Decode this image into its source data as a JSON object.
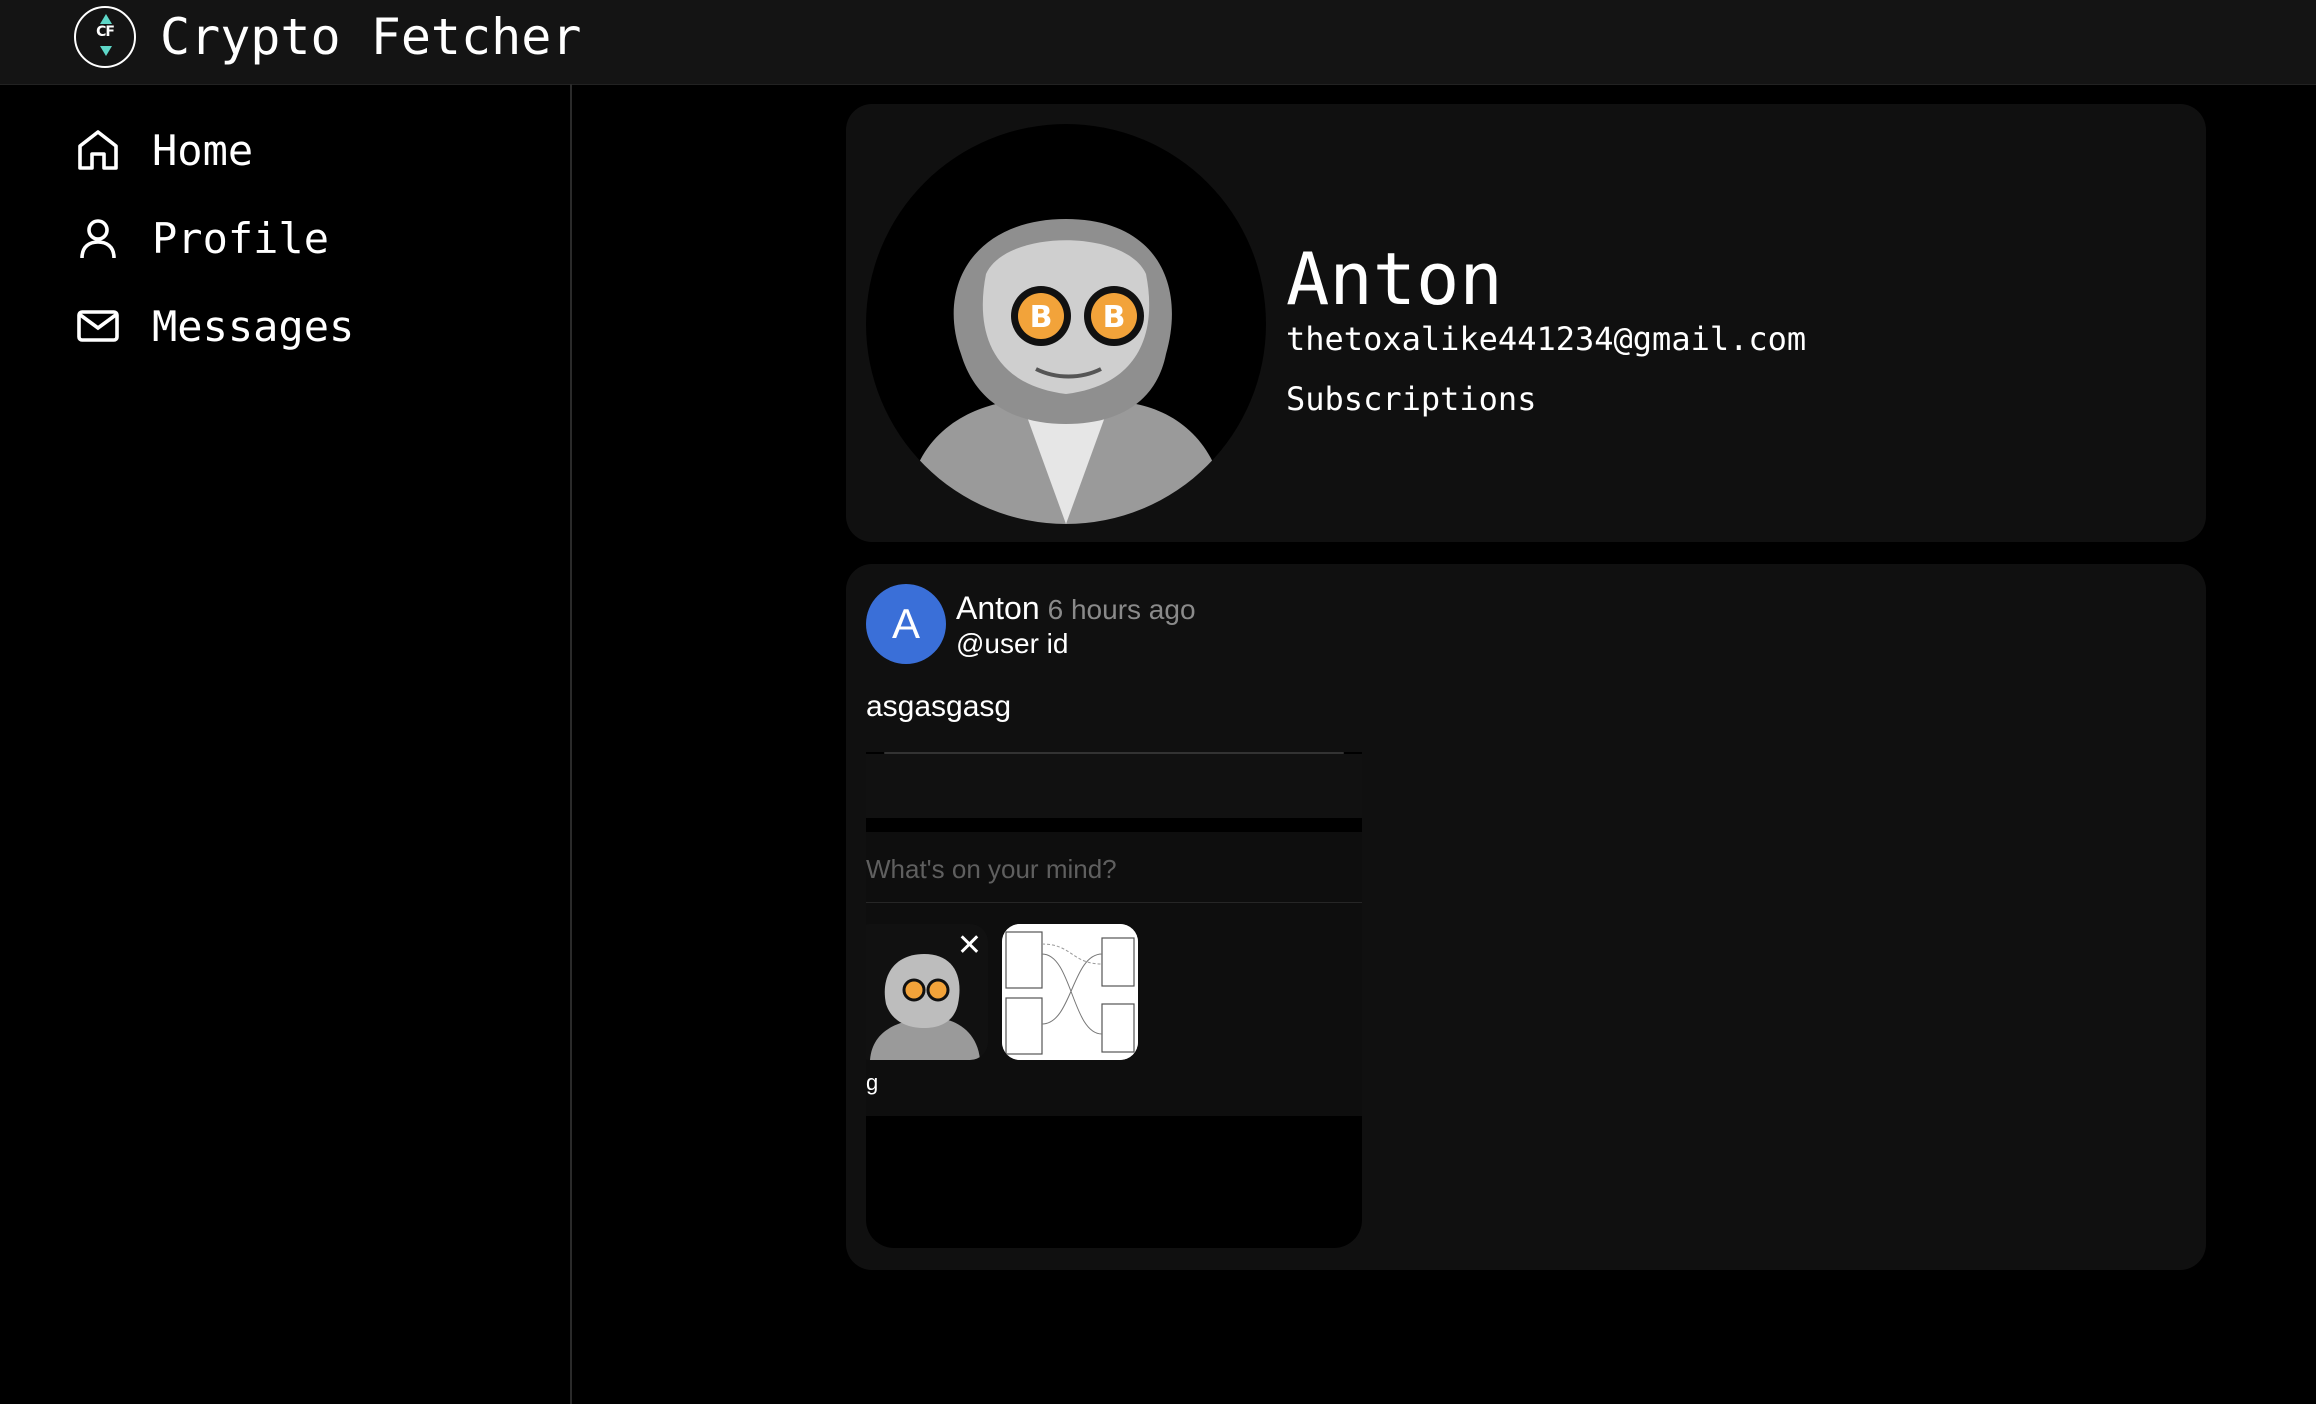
{
  "app": {
    "title": "Crypto Fetcher",
    "logo_text": "CF"
  },
  "sidebar": {
    "items": [
      {
        "label": "Home",
        "icon": "home-icon"
      },
      {
        "label": "Profile",
        "icon": "user-icon"
      },
      {
        "label": "Messages",
        "icon": "mail-icon"
      }
    ]
  },
  "profile": {
    "name": "Anton",
    "email": "thetoxalike441234@gmail.com",
    "subscriptions_label": "Subscriptions",
    "avatar": "benjamin-franklin-bitcoin-glasses-image"
  },
  "post": {
    "avatar_letter": "A",
    "author": "Anton",
    "time": "6 hours ago",
    "handle": "@user id",
    "text": "asgasgasg",
    "embed": {
      "placeholder": "What's on your mind?",
      "char": "g",
      "images": [
        "benjamin-franklin-bitcoin-image",
        "diagram-screenshot-image"
      ]
    }
  },
  "colors": {
    "accent": "#3a6fd8",
    "logo_accent": "#5ed7c8",
    "card": "#101010",
    "muted": "#8a8a8a"
  }
}
